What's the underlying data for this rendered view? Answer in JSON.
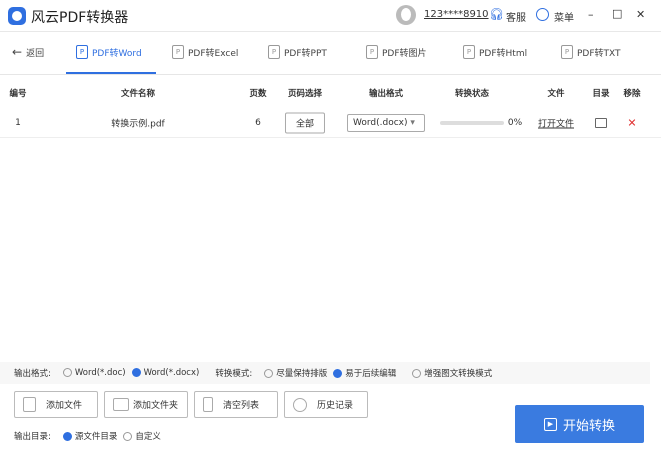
{
  "app": {
    "title": "风云PDF转换器",
    "user": "123****8910",
    "support": "客服",
    "menu": "菜单",
    "minimize": "–",
    "maximize": "□",
    "close": "✕"
  },
  "nav": {
    "back": "返回",
    "tabs": [
      {
        "label": "PDF转Word",
        "active": true
      },
      {
        "label": "PDF转Excel"
      },
      {
        "label": "PDF转PPT"
      },
      {
        "label": "PDF转图片"
      },
      {
        "label": "PDF转Html"
      },
      {
        "label": "PDF转TXT"
      }
    ]
  },
  "table": {
    "headers": [
      "编号",
      "文件名称",
      "页数",
      "页码选择",
      "输出格式",
      "转换状态",
      "文件",
      "目录",
      "移除"
    ],
    "rows": [
      {
        "index": "1",
        "name": "转换示例.pdf",
        "pages": "6",
        "range": "全部",
        "format": "Word(.docx)",
        "progress_pct": 0,
        "progress": "0%",
        "open": "打开文件"
      }
    ]
  },
  "options": {
    "format_label": "输出格式:",
    "formats": [
      "Word(*.doc)",
      "Word(*.docx)"
    ],
    "mode_label": "转换模式:",
    "modes": [
      "尽量保持排版",
      "易于后续编辑",
      "增强图文转换模式"
    ]
  },
  "actions": {
    "add_file": "添加文件",
    "add_folder": "添加文件夹",
    "clear": "清空列表",
    "history": "历史记录",
    "start": "开始转换"
  },
  "output": {
    "label": "输出目录:",
    "source": "源文件目录",
    "custom": "自定义"
  },
  "colors": {
    "accent": "#2f6fe0",
    "remove": "#e03030"
  }
}
